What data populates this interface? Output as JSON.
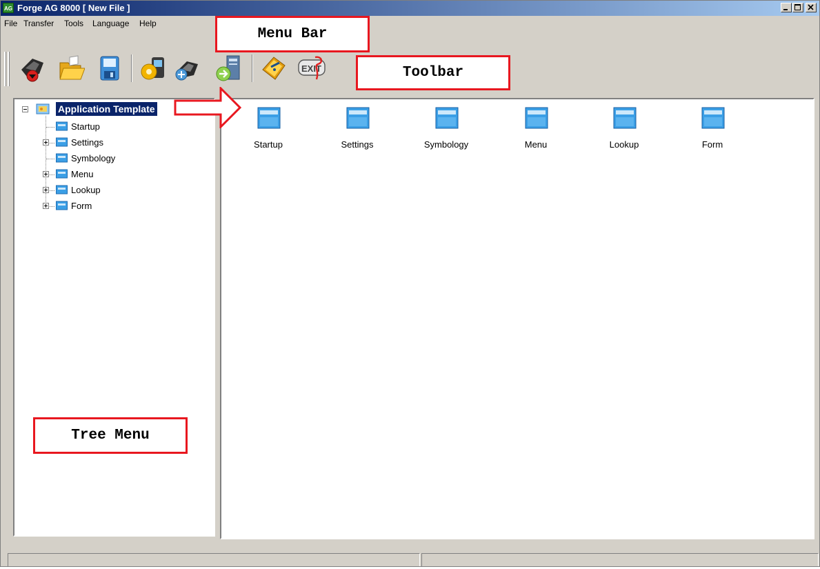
{
  "window": {
    "app_icon_text": "AG",
    "title": "Forge AG 8000 [ New File ]",
    "controls": [
      "minimize",
      "maximize",
      "close"
    ]
  },
  "menu": {
    "items": [
      "File",
      "Transfer",
      "Tools",
      "Language",
      "Help"
    ]
  },
  "toolbar": {
    "buttons": [
      {
        "icon": "new-device-icon"
      },
      {
        "icon": "open-folder-icon"
      },
      {
        "icon": "save-floppy-icon"
      },
      {
        "icon": "device-settings-icon"
      },
      {
        "icon": "device-connect-icon"
      },
      {
        "icon": "transfer-to-pc-icon"
      },
      {
        "icon": "help-book-icon"
      },
      {
        "icon": "exit-icon",
        "text": "EXIT"
      }
    ]
  },
  "tree": {
    "root": "Application Template",
    "children": [
      {
        "label": "Startup",
        "expandable": false
      },
      {
        "label": "Settings",
        "expandable": true
      },
      {
        "label": "Symbology",
        "expandable": false
      },
      {
        "label": "Menu",
        "expandable": true
      },
      {
        "label": "Lookup",
        "expandable": true
      },
      {
        "label": "Form",
        "expandable": true
      }
    ]
  },
  "content": {
    "items": [
      "Startup",
      "Settings",
      "Symbology",
      "Menu",
      "Lookup",
      "Form"
    ]
  },
  "annotations": {
    "menu_bar": "Menu Bar",
    "toolbar": "Toolbar",
    "tree_menu": "Tree Menu"
  },
  "colors": {
    "selection": "#0a246a",
    "callout_border": "#e8171f",
    "folder_blue": "#3b9fe6"
  }
}
